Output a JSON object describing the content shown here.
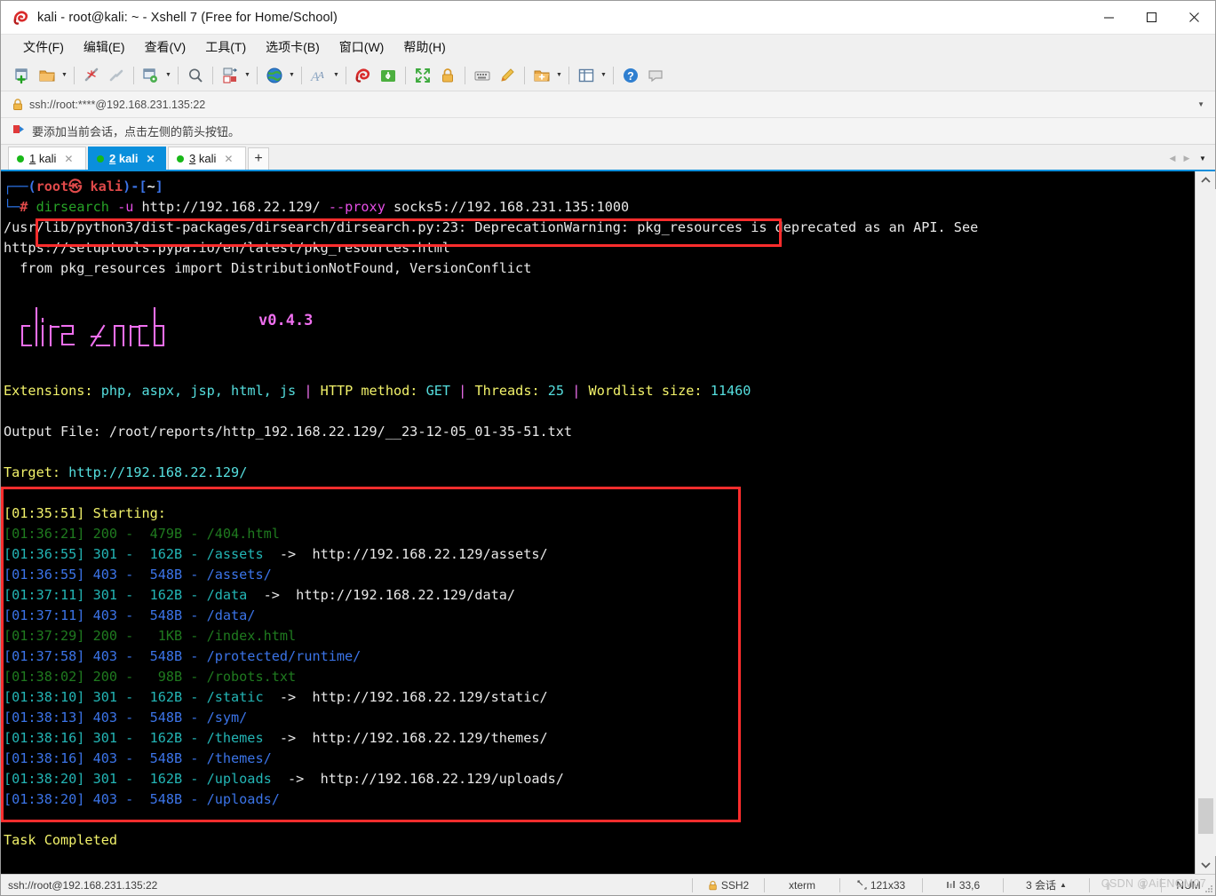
{
  "window": {
    "title": "kali - root@kali: ~ - Xshell 7 (Free for Home/School)",
    "minimize": "—",
    "maximize": "☐",
    "close": "✕"
  },
  "menubar": {
    "items": [
      {
        "label": "文件(F)",
        "name": "menu-file"
      },
      {
        "label": "编辑(E)",
        "name": "menu-edit"
      },
      {
        "label": "查看(V)",
        "name": "menu-view"
      },
      {
        "label": "工具(T)",
        "name": "menu-tools"
      },
      {
        "label": "选项卡(B)",
        "name": "menu-tabs"
      },
      {
        "label": "窗口(W)",
        "name": "menu-window"
      },
      {
        "label": "帮助(H)",
        "name": "menu-help"
      }
    ]
  },
  "toolbar": {
    "icons": [
      "new-session-icon",
      "open-folder-icon",
      "dropdown-caret",
      "disconnect-icon",
      "reconnect-icon",
      "session-properties-icon",
      "dropdown-caret",
      "find-icon",
      "transfer-file-icon",
      "dropdown-caret",
      "web-browser-icon",
      "dropdown-caret",
      "font-icon",
      "dropdown-caret",
      "xshell-icon",
      "xftp-icon",
      "fullscreen-icon",
      "lock-icon",
      "keyboard-icon",
      "highlight-icon",
      "new-folder-icon",
      "dropdown-caret",
      "layout-icon",
      "dropdown-caret",
      "help-icon",
      "comment-icon"
    ]
  },
  "address": {
    "lock_icon": "lock-icon",
    "url": "ssh://root:****@192.168.231.135:22",
    "caret": "▼"
  },
  "hint": {
    "icon": "bookmark-flag-icon",
    "text": "要添加当前会话，点击左侧的箭头按钮。"
  },
  "tabs": {
    "items": [
      {
        "num": "1",
        "label": "kali",
        "active": false
      },
      {
        "num": "2",
        "label": "kali",
        "active": true
      },
      {
        "num": "3",
        "label": "kali",
        "active": false
      }
    ],
    "add_label": "+",
    "nav_left": "◀",
    "nav_right": "▶",
    "dropdown": "▼"
  },
  "terminal": {
    "prompt_top": "┌──(root㉿ kali)-[~]",
    "prompt_user": "(root㉿ kali)",
    "prompt_path": "[~]",
    "prompt_bottom": "└─#",
    "command": {
      "name": "dirsearch",
      "flag_u": "-u",
      "url": "http://192.168.22.129/",
      "flag_proxy": "--proxy",
      "proxy": "socks5://192.168.231.135:1000"
    },
    "warning_lines": [
      "/usr/lib/python3/dist-packages/dirsearch/dirsearch.py:23: DeprecationWarning: pkg_resources is deprecated as an API. See",
      "https://setuptools.pypa.io/en/latest/pkg_resources.html",
      "  from pkg_resources import DistributionNotFound, VersionConflict"
    ],
    "logo_text": "dirsearch",
    "version": "v0.4.3",
    "info": {
      "extensions_label": "Extensions:",
      "extensions_value": "php, aspx, jsp, html, js",
      "method_label": "HTTP method:",
      "method_value": "GET",
      "threads_label": "Threads:",
      "threads_value": "25",
      "wordlist_label": "Wordlist size:",
      "wordlist_value": "11460",
      "separator": "|"
    },
    "output_file_label": "Output File:",
    "output_file_value": "/root/reports/http_192.168.22.129/__23-12-05_01-35-51.txt",
    "target_label": "Target:",
    "target_value": "http://192.168.22.129/",
    "starting_time": "[01:35:51]",
    "starting_label": "Starting:",
    "results": [
      {
        "time": "[01:36:21]",
        "status": "200",
        "size": "479B",
        "path": "/404.html",
        "arrow": "",
        "redirect": "",
        "color": "dgreen"
      },
      {
        "time": "[01:36:55]",
        "status": "301",
        "size": "162B",
        "path": "/assets",
        "arrow": "->",
        "redirect": "http://192.168.22.129/assets/",
        "color": "cyan"
      },
      {
        "time": "[01:36:55]",
        "status": "403",
        "size": "548B",
        "path": "/assets/",
        "arrow": "",
        "redirect": "",
        "color": "blue"
      },
      {
        "time": "[01:37:11]",
        "status": "301",
        "size": "162B",
        "path": "/data",
        "arrow": "->",
        "redirect": "http://192.168.22.129/data/",
        "color": "cyan"
      },
      {
        "time": "[01:37:11]",
        "status": "403",
        "size": "548B",
        "path": "/data/",
        "arrow": "",
        "redirect": "",
        "color": "blue"
      },
      {
        "time": "[01:37:29]",
        "status": "200",
        "size": "1KB",
        "path": "/index.html",
        "arrow": "",
        "redirect": "",
        "color": "dgreen"
      },
      {
        "time": "[01:37:58]",
        "status": "403",
        "size": "548B",
        "path": "/protected/runtime/",
        "arrow": "",
        "redirect": "",
        "color": "blue"
      },
      {
        "time": "[01:38:02]",
        "status": "200",
        "size": "98B",
        "path": "/robots.txt",
        "arrow": "",
        "redirect": "",
        "color": "dgreen"
      },
      {
        "time": "[01:38:10]",
        "status": "301",
        "size": "162B",
        "path": "/static",
        "arrow": "->",
        "redirect": "http://192.168.22.129/static/",
        "color": "cyan"
      },
      {
        "time": "[01:38:13]",
        "status": "403",
        "size": "548B",
        "path": "/sym/",
        "arrow": "",
        "redirect": "",
        "color": "blue"
      },
      {
        "time": "[01:38:16]",
        "status": "301",
        "size": "162B",
        "path": "/themes",
        "arrow": "->",
        "redirect": "http://192.168.22.129/themes/",
        "color": "cyan"
      },
      {
        "time": "[01:38:16]",
        "status": "403",
        "size": "548B",
        "path": "/themes/",
        "arrow": "",
        "redirect": "",
        "color": "blue"
      },
      {
        "time": "[01:38:20]",
        "status": "301",
        "size": "162B",
        "path": "/uploads",
        "arrow": "->",
        "redirect": "http://192.168.22.129/uploads/",
        "color": "cyan"
      },
      {
        "time": "[01:38:20]",
        "status": "403",
        "size": "548B",
        "path": "/uploads/",
        "arrow": "",
        "redirect": "",
        "color": "blue"
      }
    ],
    "task_completed": "Task Completed"
  },
  "statusbar": {
    "connection": "ssh://root@192.168.231.135:22",
    "protocol": "SSH2",
    "terminal_type": "xterm",
    "size": "121x33",
    "cursor": "33,6",
    "sessions": "3 会话",
    "sessions_caret": "▲",
    "upload_icon": "upload-arrow-icon",
    "download_icon": "download-arrow-icon",
    "num_lock": "NUM",
    "watermark": "CSDN @AiENGM07"
  },
  "colors": {
    "accent": "#0a8fdc",
    "highlight_box": "#ff2d2d",
    "terminal_bg": "#000000",
    "status_200": "#1f7a1f",
    "status_301": "#23b5b5",
    "status_403": "#3b74e8",
    "label_yellow": "#f2f26a",
    "magenta": "#ef6fef"
  }
}
